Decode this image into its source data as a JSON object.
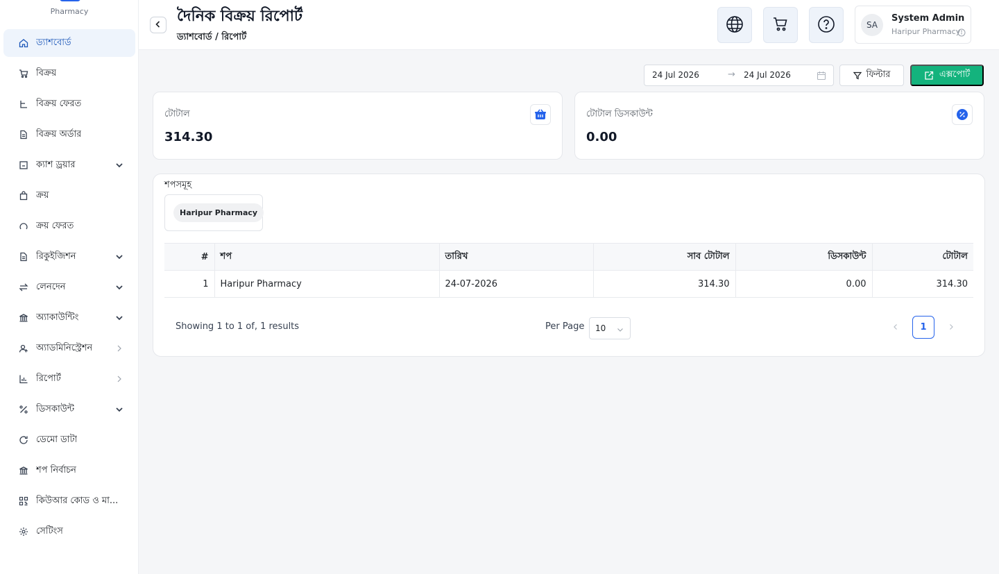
{
  "brand": {
    "subtitle": "Pharmacy"
  },
  "sidebar": {
    "items": [
      {
        "label": "ড্যাশবোর্ড",
        "icon": "home-icon",
        "active": true,
        "caret": ""
      },
      {
        "label": "বিক্রয়",
        "icon": "cart-icon",
        "caret": ""
      },
      {
        "label": "বিক্রয় ফেরত",
        "icon": "return-icon",
        "caret": ""
      },
      {
        "label": "বিক্রয় অর্ডার",
        "icon": "document-icon",
        "caret": ""
      },
      {
        "label": "ক্যাশ ড্রয়ার",
        "icon": "cash-drawer-icon",
        "caret": "down"
      },
      {
        "label": "ক্রয়",
        "icon": "bag-icon",
        "caret": ""
      },
      {
        "label": "ক্রয় ফেরত",
        "icon": "undo-icon",
        "caret": ""
      },
      {
        "label": "রিকুইজিশন",
        "icon": "requisition-icon",
        "caret": "down"
      },
      {
        "label": "লেনদেন",
        "icon": "transfer-icon",
        "caret": "down"
      },
      {
        "label": "অ্যাকাউন্টিং",
        "icon": "bank-icon",
        "caret": "down"
      },
      {
        "label": "অ্যাডমিনিস্ট্রেশন",
        "icon": "admin-users-icon",
        "caret": "right"
      },
      {
        "label": "রিপোর্ট",
        "icon": "bar-chart-icon",
        "caret": "right"
      },
      {
        "label": "ডিসকাউন্ট",
        "icon": "percent-icon",
        "caret": "down"
      },
      {
        "label": "ডেমো ডাটা",
        "icon": "reload-icon",
        "caret": ""
      },
      {
        "label": "শপ নির্বাচন",
        "icon": "shop-icon",
        "caret": ""
      },
      {
        "label": "কিউআর কোড ও মা...",
        "icon": "qr-code-icon",
        "caret": ""
      },
      {
        "label": "সেটিংস",
        "icon": "settings-icon",
        "caret": ""
      }
    ]
  },
  "header": {
    "title": "দৈনিক বিক্রয় রিপোর্ট",
    "breadcrumb": "ড্যাশবোর্ড / রিপোর্ট",
    "user": {
      "initials": "SA",
      "name": "System Admin",
      "org": "Haripur Pharmacy"
    }
  },
  "toolbar": {
    "date_from": "24 Jul 2026",
    "date_to": "24 Jul 2026",
    "date_arrow": "→",
    "filter_label": "ফিল্টার",
    "export_label": "এক্সপোর্ট"
  },
  "cards": {
    "total": {
      "label": "টোটাল",
      "value": "314.30"
    },
    "discount": {
      "label": "টোটাল ডিসকাউন্ট",
      "value": "0.00"
    }
  },
  "shops": {
    "title": "শপসমূহ",
    "items": [
      "Haripur Pharmacy"
    ]
  },
  "table": {
    "columns": [
      "#",
      "শপ",
      "তারিখ",
      "সাব টোটাল",
      "ডিসকাউন্ট",
      "টোটাল"
    ],
    "rows": [
      [
        "1",
        "Haripur Pharmacy",
        "24-07-2026",
        "314.30",
        "0.00",
        "314.30"
      ]
    ]
  },
  "pagination": {
    "summary": "Showing 1 to 1 of, 1 results",
    "per_page_label": "Per Page",
    "per_page_value": "10",
    "current_page": "1"
  },
  "colors": {
    "accent": "#2563eb",
    "export_green": "#14b37d",
    "active_nav_bg": "#eef4fc"
  }
}
